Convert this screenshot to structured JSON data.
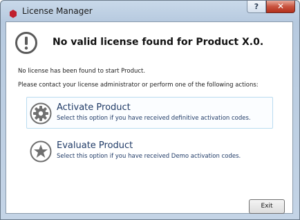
{
  "window": {
    "title": "License Manager",
    "help_label": "?",
    "close_label": "✕"
  },
  "header": {
    "icon": "exclamation-circle-icon",
    "title": "No valid license found for Product X.0."
  },
  "messages": {
    "line1": "No license has been found to start Product.",
    "line2": "Please contact your license administrator or perform one of the following actions:"
  },
  "options": [
    {
      "icon": "gear-icon",
      "title": "Activate Product",
      "description": "Select this option if you have received definitive activation codes.",
      "highlighted": true
    },
    {
      "icon": "star-icon",
      "title": "Evaluate Product",
      "description": "Select this option if you have received Demo activation codes.",
      "highlighted": false
    }
  ],
  "footer": {
    "exit_label": "Exit"
  },
  "colors": {
    "app_icon": "#c0202d",
    "option_title": "#1f3a66",
    "icon_gray": "#707070",
    "highlight_border": "#b9dcf0"
  }
}
